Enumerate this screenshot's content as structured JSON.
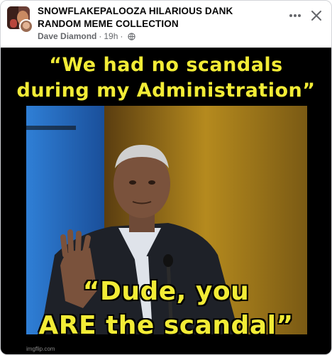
{
  "post": {
    "group_name": "SNOWFLAKEPALOOZA HILARIOUS DANK RANDOM MEME COLLECTION",
    "author": "Dave Diamond",
    "separator": "·",
    "time": "19h",
    "privacy_icon": "globe-icon",
    "more_icon": "more-options-icon",
    "close_icon": "close-icon"
  },
  "meme": {
    "top_line1": "“We had no scandals",
    "top_line2": "during my Administration”",
    "bottom_line1": "“Dude, you",
    "bottom_line2": "ARE the scandal”",
    "watermark": "imgflip.com"
  },
  "colors": {
    "caption_text": "#f2ec36",
    "meme_background": "#000000",
    "stage_left": "#2f7fd6",
    "stage_right": "#b58a1e"
  }
}
